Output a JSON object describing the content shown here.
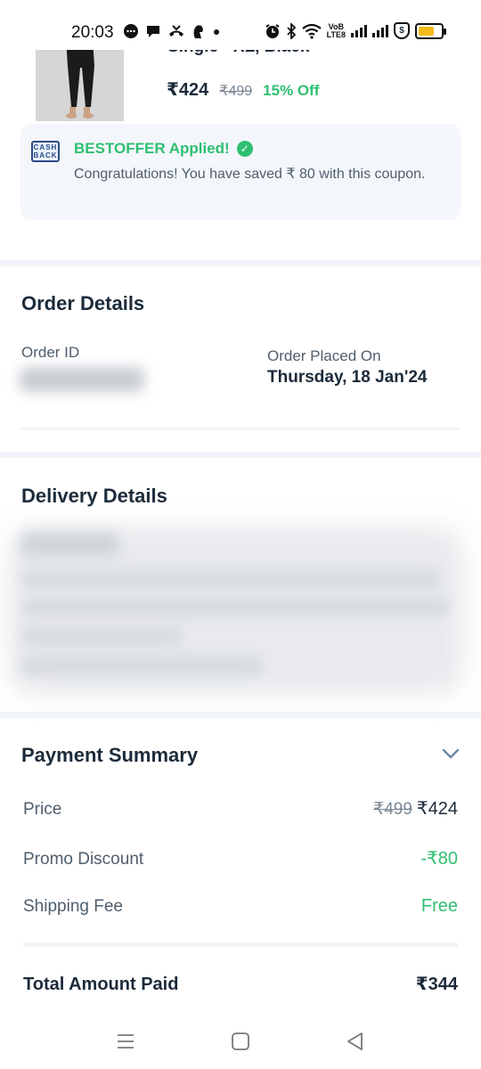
{
  "status_bar": {
    "time": "20:03",
    "left_icons": [
      "chat-bubble-icon",
      "message-icon",
      "missed-call-icon",
      "hand-icon",
      "dot-icon"
    ],
    "right_icons": [
      "alarm-icon",
      "bluetooth-icon",
      "wifi-icon",
      "volte-icon",
      "signal-icon",
      "signal-icon",
      "shield-icon",
      "battery-icon"
    ],
    "volte_line1": "VoB",
    "volte_line2": "LTE8",
    "shield_symbol": "$",
    "battery_level": 0.7,
    "battery_color": "#f3b81b"
  },
  "product": {
    "variant": "Single - XL, Black",
    "price": "₹424",
    "mrp": "₹499",
    "discount": "15% Off"
  },
  "coupon": {
    "icon_text_line1": "CASH",
    "icon_text_line2": "BACK",
    "title": "BESTOFFER Applied!",
    "message": "Congratulations! You have saved ₹ 80 with this coupon."
  },
  "order_details": {
    "title": "Order Details",
    "order_id_label": "Order ID",
    "placed_on_label": "Order Placed On",
    "placed_on_value": "Thursday, 18 Jan'24"
  },
  "delivery_details": {
    "title": "Delivery Details"
  },
  "payment_summary": {
    "title": "Payment Summary",
    "price_label": "Price",
    "price_mrp": "₹499",
    "price_value": "₹424",
    "promo_label": "Promo Discount",
    "promo_value": "-₹80",
    "shipping_label": "Shipping Fee",
    "shipping_value": "Free",
    "total_label": "Total Amount Paid",
    "total_value": "₹344"
  },
  "nav_bar": {
    "icons": [
      "menu-icon",
      "home-icon",
      "back-icon"
    ]
  },
  "colors": {
    "accent_green": "#2fbf71",
    "text_dark": "#1c2b3a",
    "text_muted": "#4f5e6d",
    "band": "#f1f5f9"
  }
}
